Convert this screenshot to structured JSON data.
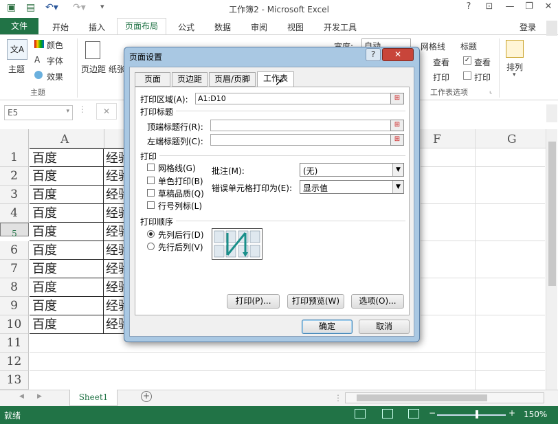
{
  "window": {
    "title": "工作簿2 - Microsoft Excel",
    "help": "?",
    "login": "登录"
  },
  "ribbon_tabs": [
    "文件",
    "开始",
    "插入",
    "页面布局",
    "公式",
    "数据",
    "审阅",
    "视图",
    "开发工具"
  ],
  "ribbon": {
    "theme": {
      "main": "主题",
      "colors": "颜色",
      "fonts": "字体",
      "effects": "效果",
      "group": "主题"
    },
    "margins": "页边距",
    "orientation": "纸张",
    "width_label": "宽度:",
    "width_value": "自动",
    "gridlines": {
      "title": "网格线",
      "view": "查看",
      "print": "打印"
    },
    "headings": {
      "title": "标题",
      "view": "查看",
      "print": "打印"
    },
    "sheet_options_group": "工作表选项",
    "arrange": "排列"
  },
  "formula": {
    "namebox": "E5"
  },
  "columns": [
    "A",
    "F",
    "G"
  ],
  "rows": [
    "1",
    "2",
    "3",
    "4",
    "5",
    "6",
    "7",
    "8",
    "9",
    "10",
    "11",
    "12",
    "13"
  ],
  "cells_a": [
    "百度",
    "百度",
    "百度",
    "百度",
    "百度",
    "百度",
    "百度",
    "百度",
    "百度",
    "百度"
  ],
  "cells_b": [
    "经验",
    "经验",
    "经验",
    "经验",
    "经验",
    "经验",
    "经验",
    "经验",
    "经验",
    "经验"
  ],
  "sheet_tab": "Sheet1",
  "status": {
    "ready": "就绪",
    "zoom": "150%"
  },
  "dialog": {
    "title": "页面设置",
    "tabs": [
      "页面",
      "页边距",
      "页眉/页脚",
      "工作表"
    ],
    "print_area_label": "打印区域(A):",
    "print_area_value": "A1:D10",
    "print_titles": "打印标题",
    "rows_repeat": "顶端标题行(R):",
    "cols_repeat": "左端标题列(C):",
    "print_section": "打印",
    "checks": [
      "网格线(G)",
      "单色打印(B)",
      "草稿品质(Q)",
      "行号列标(L)"
    ],
    "comments_label": "批注(M):",
    "comments_value": "(无)",
    "errors_label": "错误单元格打印为(E):",
    "errors_value": "显示值",
    "order_section": "打印顺序",
    "order_options": [
      "先列后行(D)",
      "先行后列(V)"
    ],
    "btn_print": "打印(P)...",
    "btn_preview": "打印预览(W)",
    "btn_options": "选项(O)...",
    "btn_ok": "确定",
    "btn_cancel": "取消"
  }
}
